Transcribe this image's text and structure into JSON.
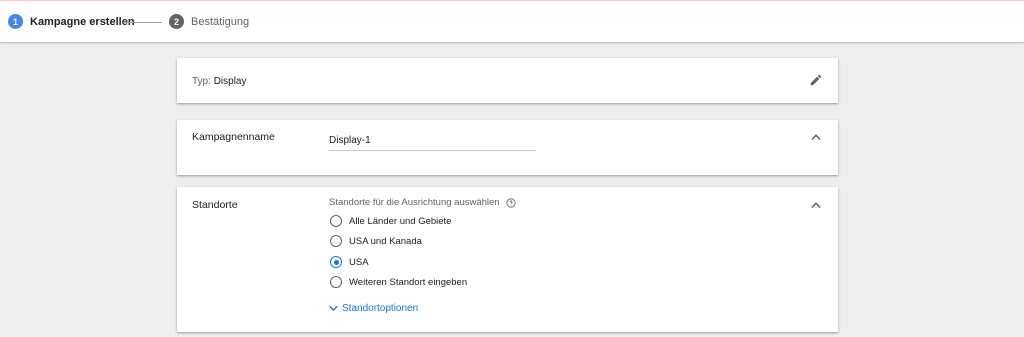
{
  "stepper": {
    "steps": [
      {
        "number": "1",
        "label": "Kampagne erstellen"
      },
      {
        "number": "2",
        "label": "Bestätigung"
      }
    ]
  },
  "type_card": {
    "prefix": "Typ: ",
    "value": "Display",
    "edit_icon": "pencil-icon"
  },
  "name_card": {
    "title": "Kampagnenname",
    "input_value": "Display-1",
    "collapse_icon": "chevron-up-icon"
  },
  "locations_card": {
    "title": "Standorte",
    "hint": "Standorte für die Ausrichtung auswählen",
    "help_icon": "help-circle-icon",
    "collapse_icon": "chevron-up-icon",
    "options": [
      {
        "label": "Alle Länder und Gebiete",
        "selected": false
      },
      {
        "label": "USA und Kanada",
        "selected": false
      },
      {
        "label": "USA",
        "selected": true
      },
      {
        "label": "Weiteren Standort eingeben",
        "selected": false
      }
    ],
    "more_link": "Standortoptionen",
    "more_icon": "chevron-down-icon"
  },
  "colors": {
    "accent": "#1a73e8",
    "step_active": "#4285f4",
    "step_inactive": "#5f6368",
    "background": "#eeeeee"
  }
}
